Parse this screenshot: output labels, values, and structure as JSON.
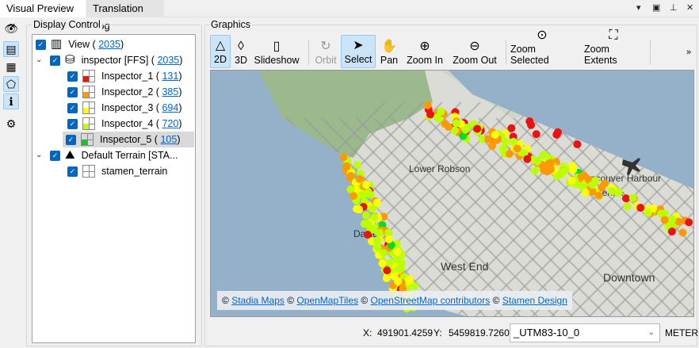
{
  "tabs": [
    {
      "label": "Visual Preview",
      "close": "×"
    },
    {
      "label": "Translation Log"
    }
  ],
  "window_controls": [
    "▾",
    "▣",
    "⊥",
    "✕"
  ],
  "display_control": {
    "title": "Display Control",
    "tree": [
      {
        "label": "View (",
        "count": "2035",
        "suffix": ")",
        "icon": "view-icon"
      },
      {
        "label": "inspector [FFS] (",
        "count": "2035",
        "suffix": ")",
        "icon": "database-icon"
      },
      {
        "label": "Inspector_1 (",
        "count": "131",
        "suffix": ")",
        "color": "#ee1111"
      },
      {
        "label": "Inspector_2 (",
        "count": "385",
        "suffix": ")",
        "color": "#ff9900"
      },
      {
        "label": "Inspector_3 (",
        "count": "694",
        "suffix": ")",
        "color": "#ffff00"
      },
      {
        "label": "Inspector_4 (",
        "count": "720",
        "suffix": ")",
        "color": "#bbff00"
      },
      {
        "label": "Inspector_5 (",
        "count": "105",
        "suffix": ")",
        "color": "#00cc22"
      },
      {
        "label": "Default Terrain [STA...",
        "icon": "terrain-icon"
      },
      {
        "label": "stamen_terrain"
      }
    ]
  },
  "graphics": {
    "title": "Graphics",
    "toolbar": [
      {
        "label": "2D",
        "glyph": "△"
      },
      {
        "label": "3D",
        "glyph": "◊"
      },
      {
        "label": "Slideshow",
        "glyph": "▯"
      },
      {
        "label": "Orbit",
        "glyph": "↻"
      },
      {
        "label": "Select",
        "glyph": "➤"
      },
      {
        "label": "Pan",
        "glyph": "✋"
      },
      {
        "label": "Zoom In",
        "glyph": "⊕"
      },
      {
        "label": "Zoom Out",
        "glyph": "⊖"
      },
      {
        "label": "Zoom Selected",
        "glyph": "⊙"
      },
      {
        "label": "Zoom Extents",
        "glyph": "⛶"
      }
    ],
    "more": "»"
  },
  "map": {
    "labels": [
      "Lower Robson",
      "Vancouver Harbour",
      "Centre",
      "Davie",
      "West End",
      "Downtown"
    ],
    "attribution": {
      "c": "©",
      "links": [
        "Stadia Maps",
        "OpenMapTiles",
        "OpenStreetMap contributors",
        "Stamen Design"
      ]
    }
  },
  "status": {
    "x_label": "X:",
    "x": "491901.4259",
    "y_label": "Y:",
    "y": "5459819.7260",
    "crs": "_UTM83-10_0",
    "units": "METER"
  }
}
